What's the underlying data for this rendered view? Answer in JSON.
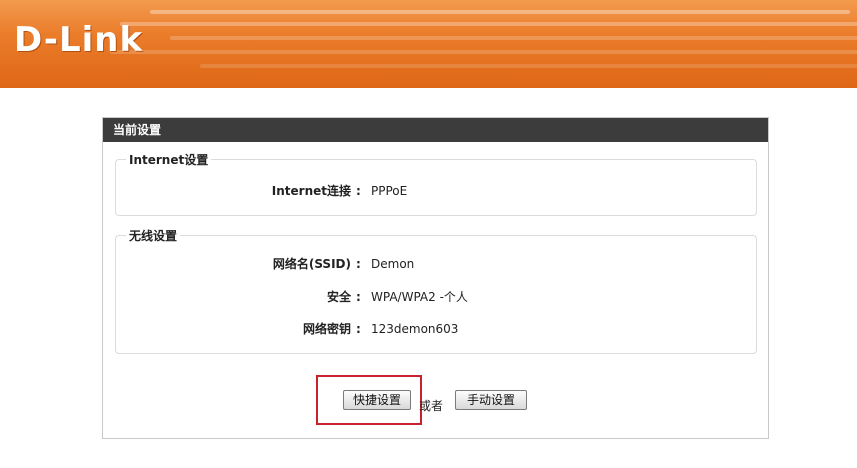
{
  "brand": {
    "logo_text": "D-Link",
    "banner_color": "#e6761f"
  },
  "panel": {
    "title": "当前设置",
    "internet": {
      "legend": "Internet设置",
      "rows": [
        {
          "label": "Internet连接",
          "colon": ":",
          "value": "PPPoE"
        }
      ]
    },
    "wireless": {
      "legend": "无线设置",
      "rows": [
        {
          "label": "网络名(SSID)",
          "colon": ":",
          "value": "Demon"
        },
        {
          "label": "安全",
          "colon": ":",
          "value": "WPA/WPA2 -个人"
        },
        {
          "label": "网络密钥",
          "colon": ":",
          "value": "123demon603"
        }
      ]
    }
  },
  "actions": {
    "quick_setup_label": "快捷设置",
    "or_text": "或者",
    "manual_setup_label": "手动设置",
    "highlight_color": "#c8232c"
  }
}
